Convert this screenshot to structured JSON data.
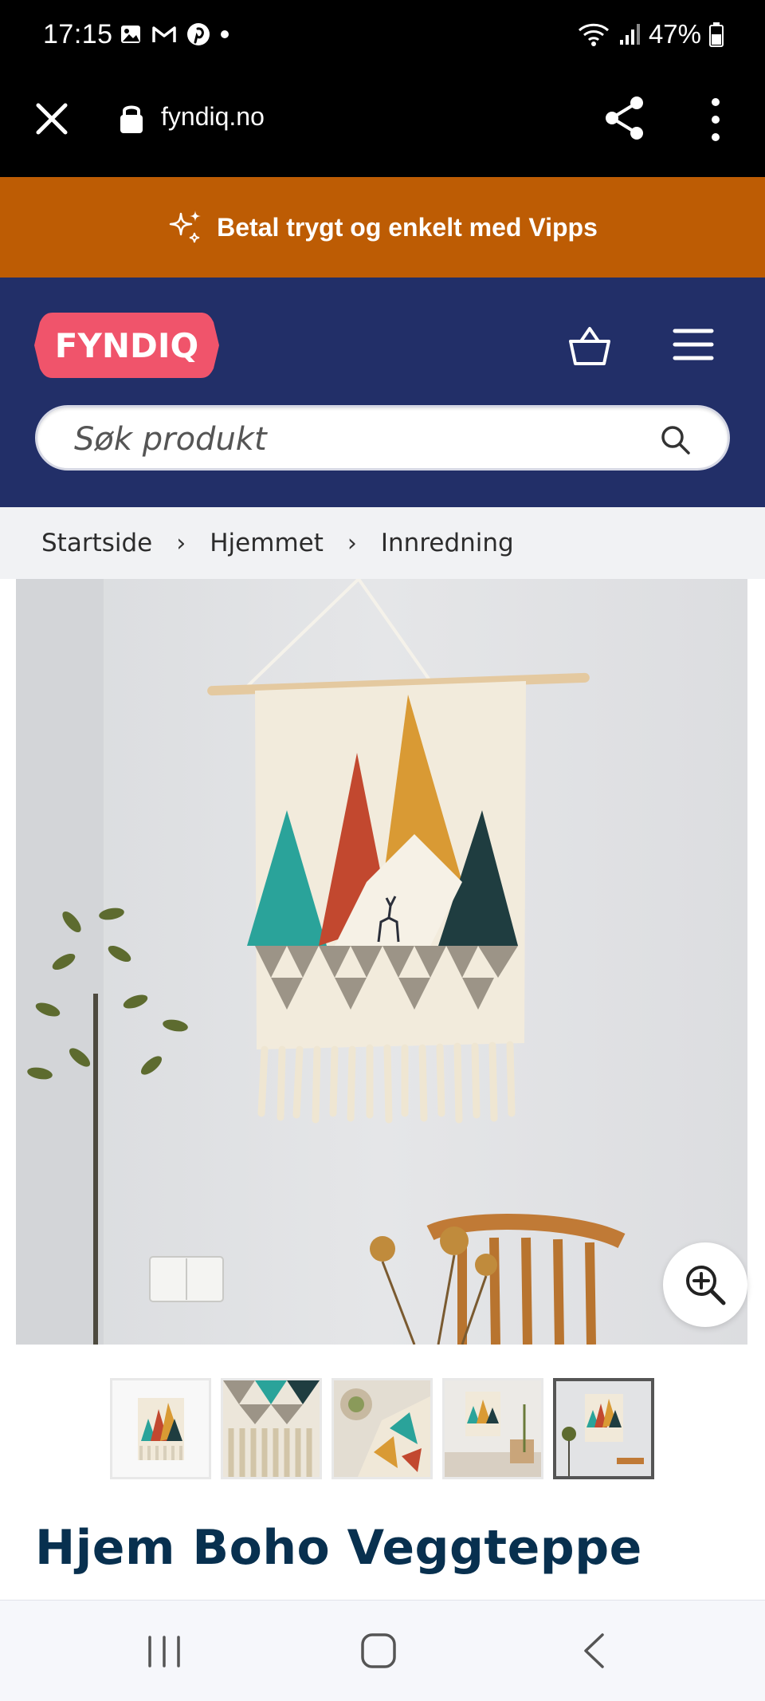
{
  "status_bar": {
    "time": "17:15",
    "battery": "47%"
  },
  "browser": {
    "url": "fyndiq.no"
  },
  "banner": {
    "text": "Betal trygt og enkelt med Vipps"
  },
  "header": {
    "logo_text": "FYNDIQ"
  },
  "search": {
    "placeholder": "Søk produkt"
  },
  "breadcrumb": {
    "items": [
      "Startside",
      "Hjemmet",
      "Innredning"
    ]
  },
  "thumbnails": {
    "count": 5,
    "active_index": 4
  },
  "product": {
    "title": "Hjem Boho Veggteppe"
  },
  "colors": {
    "banner": "#bd5c04",
    "header": "#222f68",
    "logo": "#f0546b",
    "title": "#08304f"
  }
}
